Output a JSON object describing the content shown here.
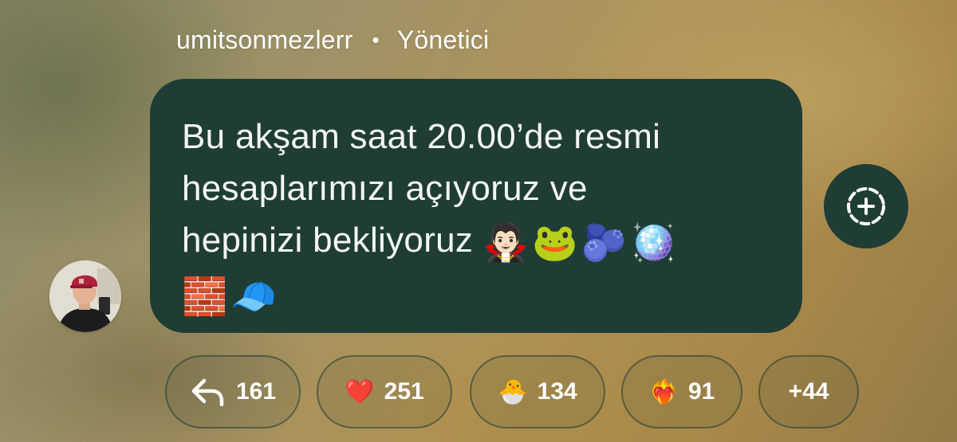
{
  "message": {
    "author": "umitsonmezlerr",
    "separator": "•",
    "role": "Yönetici",
    "text": "Bu akşam saat 20.00’de resmi\nhesaplarımızı açıyoruz ve\nhepinizi bekliyoruz ",
    "emojis": [
      "🧛🏻",
      "🐸",
      "🫐",
      "🪩",
      "🧱",
      "🧢"
    ],
    "bubble_color": "#1f3d35"
  },
  "add_reaction": {
    "icon": "add-reaction-icon"
  },
  "reactions": [
    {
      "name": "reply",
      "icon": "reply-arrow-icon",
      "count": "161"
    },
    {
      "name": "heart",
      "emoji": "❤️",
      "count": "251"
    },
    {
      "name": "hatching-chick",
      "emoji": "🐣",
      "count": "134"
    },
    {
      "name": "heart-on-fire",
      "emoji": "❤️‍🔥",
      "count": "91"
    },
    {
      "name": "more",
      "count": "+44"
    }
  ]
}
